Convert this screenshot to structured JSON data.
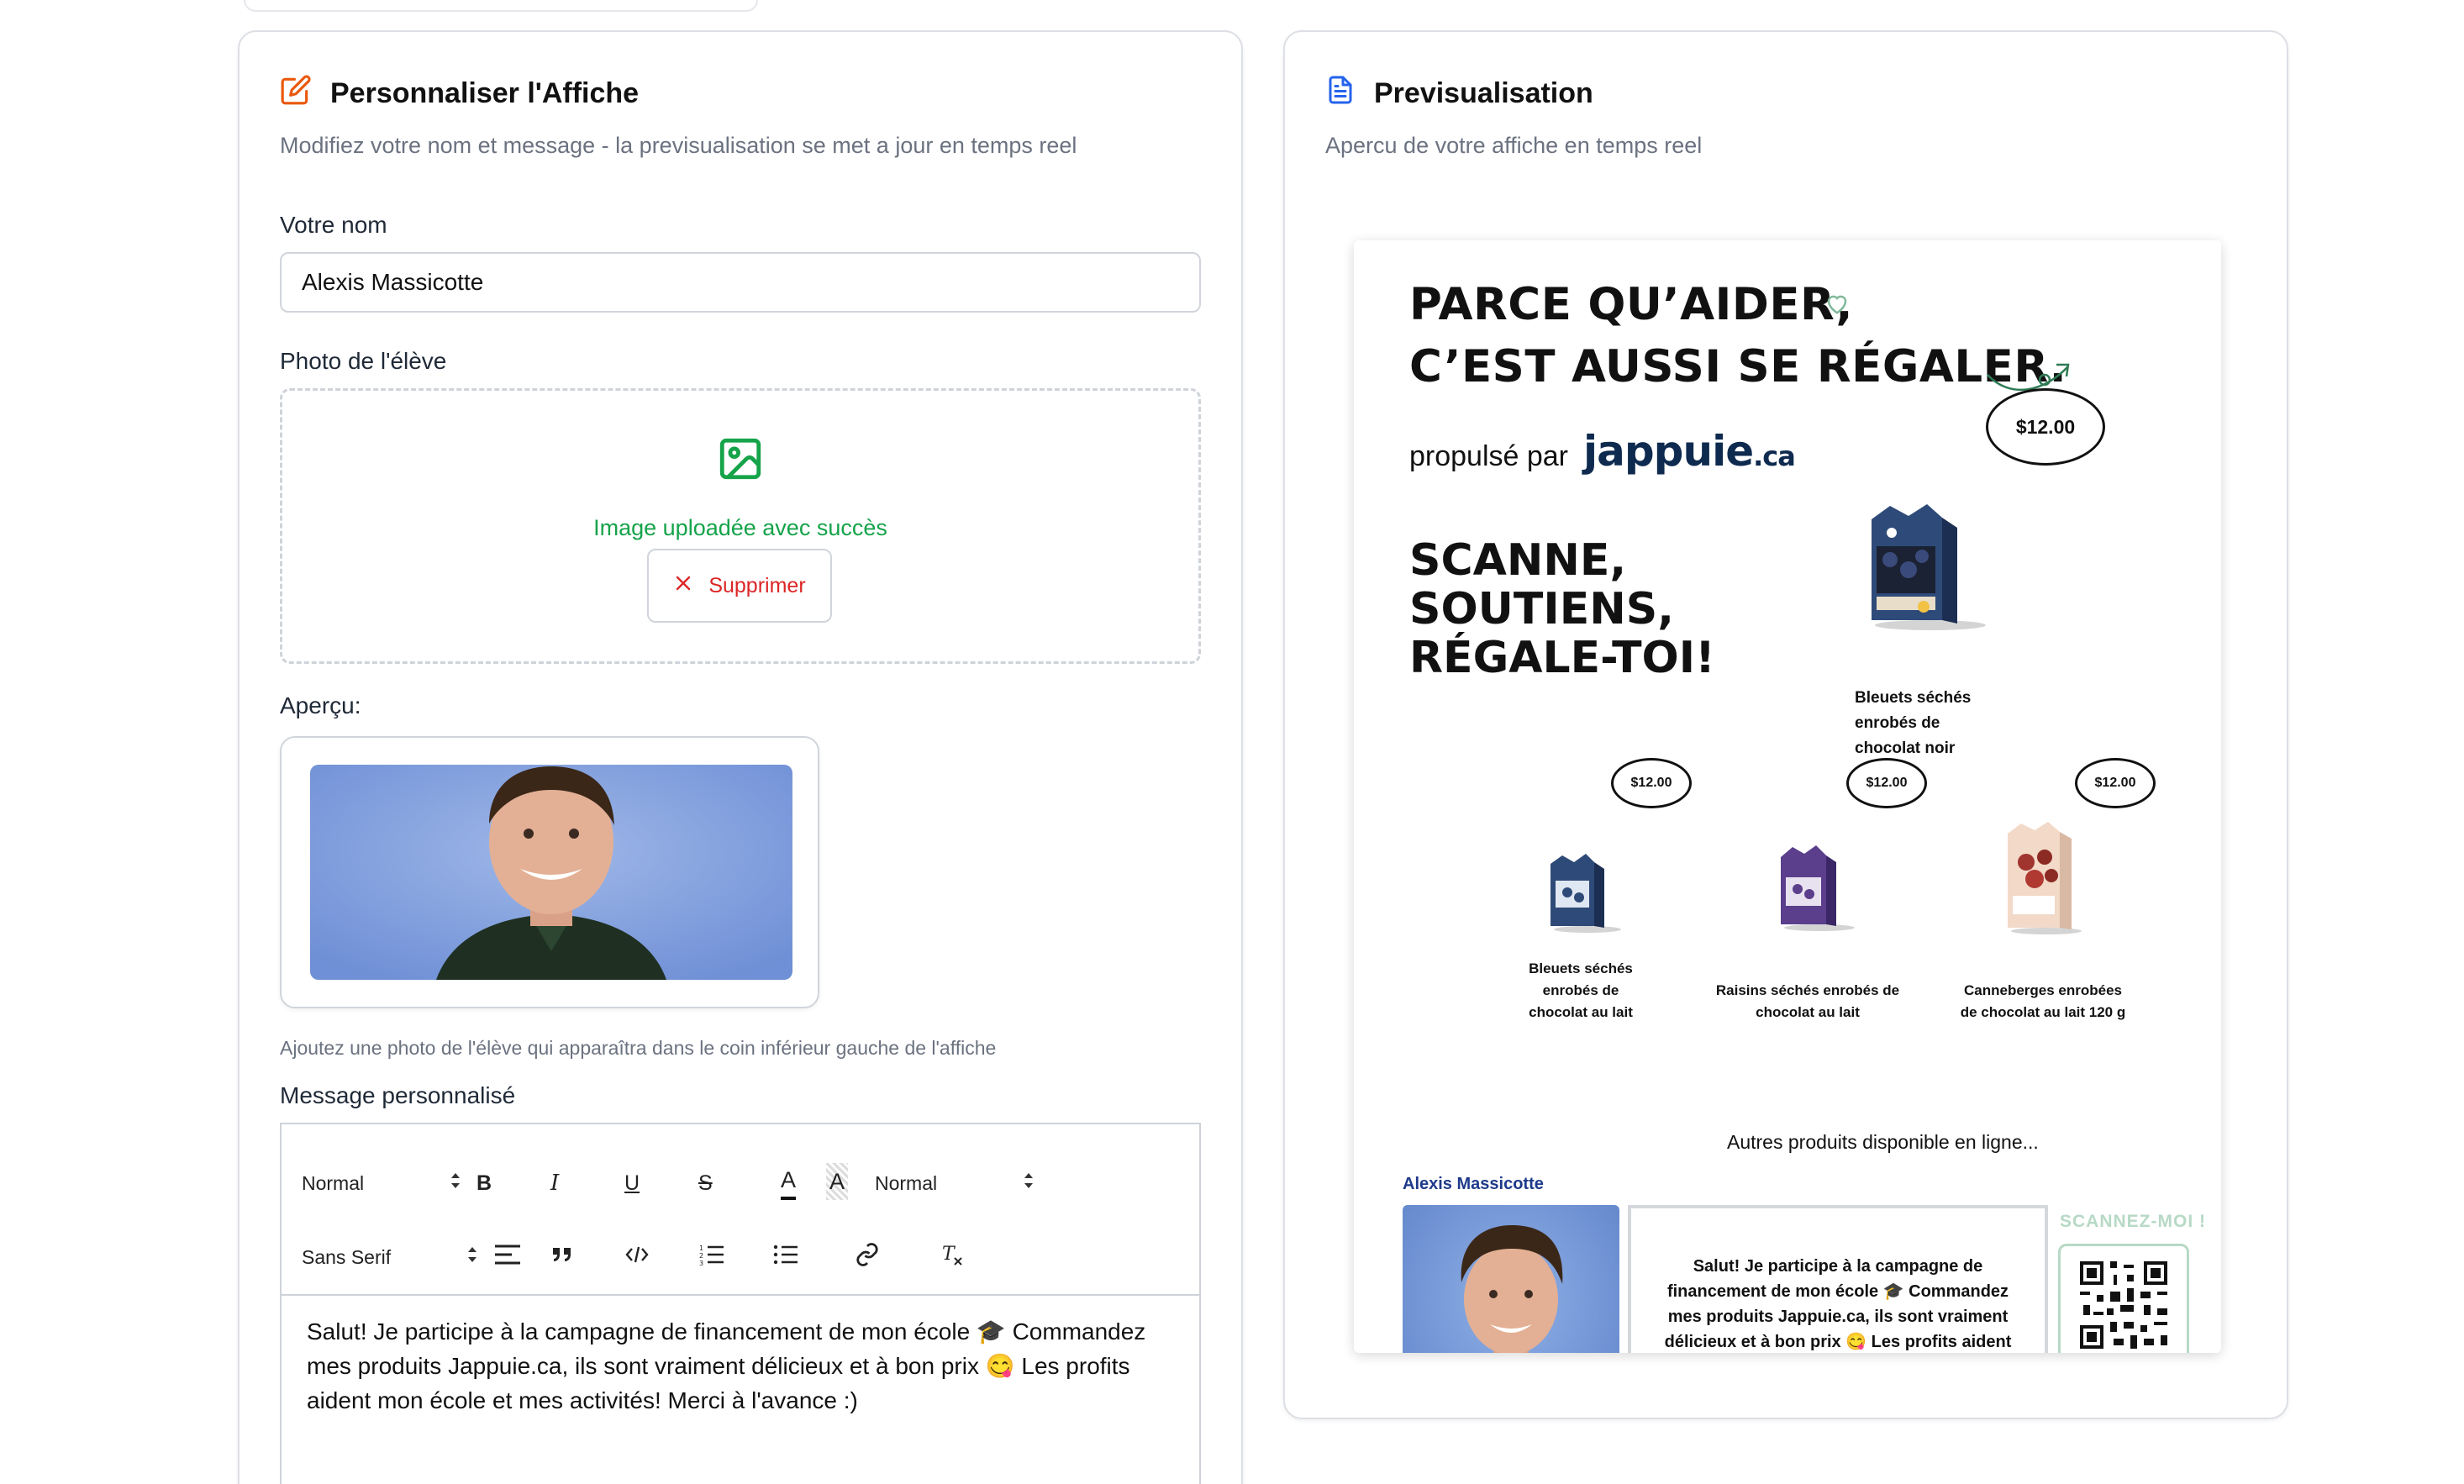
{
  "editor_panel": {
    "title": "Personnaliser l'Affiche",
    "subtitle": "Modifiez votre nom et message - la previsualisation se met a jour en temps reel",
    "name_label": "Votre nom",
    "name_value": "Alexis Massicotte",
    "photo_label": "Photo de l'élève",
    "upload_success": "Image uploadée avec succès",
    "remove_label": "Supprimer",
    "preview_label": "Aperçu:",
    "photo_hint": "Ajoutez une photo de l'élève qui apparaîtra dans le coin inférieur gauche de l'affiche",
    "message_label": "Message personnalisé",
    "toolbar": {
      "header_select": "Normal",
      "size_select": "Normal",
      "font_select": "Sans Serif",
      "bold": "B",
      "italic": "I",
      "underline": "U",
      "strike": "S",
      "color": "A",
      "background": "A"
    },
    "message_text": "Salut! Je participe à la campagne de financement de mon école 🎓 Commandez mes produits Jappuie.ca, ils sont vraiment délicieux et à bon prix 😋 Les profits aident mon école et mes activités! Merci à l'avance :)"
  },
  "preview_panel": {
    "title": "Previsualisation",
    "subtitle": "Apercu de votre affiche en temps reel",
    "poster": {
      "headline_1": "PARCE QU’AIDER,",
      "headline_2": "C’EST AUSSI SE RÉGALER.",
      "propulse": "propulsé par",
      "brand": "jappuie",
      "brand_tld": ".ca",
      "main_price": "$12.00",
      "scan_1": "SCANNE,",
      "scan_2": "SOUTIENS,",
      "scan_3": "RÉGALE-TOI!",
      "featured_product": [
        "Bleuets séchés",
        "enrobés de",
        "chocolat noir"
      ],
      "products": [
        {
          "price": "$12.00",
          "name": [
            "Bleuets séchés",
            "enrobés de",
            "chocolat au lait"
          ]
        },
        {
          "price": "$12.00",
          "name": [
            "Raisins séchés enrobés de",
            "chocolat au lait"
          ]
        },
        {
          "price": "$12.00",
          "name": [
            "Canneberges enrobées",
            "de chocolat au lait 120 g"
          ]
        }
      ],
      "other_products": "Autres produits disponible en ligne...",
      "student_name": "Alexis Massicotte",
      "message": "Salut! Je participe à la campagne de financement de mon école 🎓 Commandez mes produits Jappuie.ca, ils sont vraiment délicieux et à bon prix 😋 Les profits aident mon école et mes activités! Merci à l'avance :)",
      "scan_me": "SCANNEZ-MOI !"
    }
  },
  "colors": {
    "edit_icon": "#ea580c",
    "doc_icon": "#2563eb",
    "success": "#16a34a",
    "danger": "#dc2626",
    "student_name": "#1e3a8a",
    "qr_accent": "#b7d9c5"
  }
}
